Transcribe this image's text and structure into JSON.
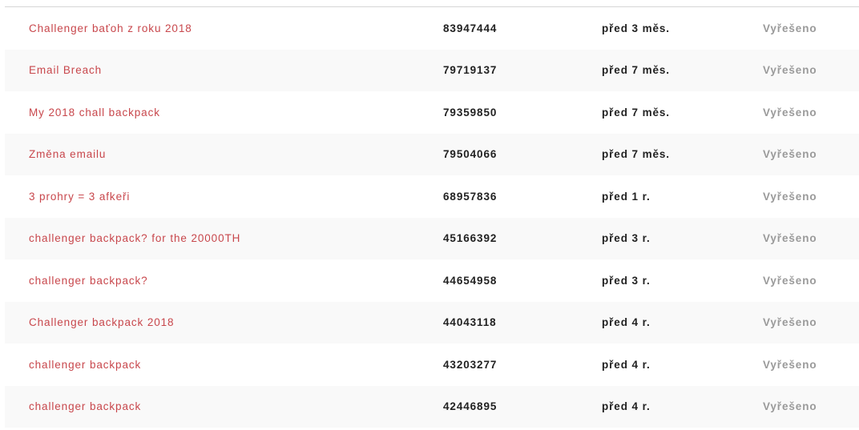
{
  "tickets": [
    {
      "subject": "Challenger baťoh z roku 2018",
      "id": "83947444",
      "date": "před 3 měs.",
      "status": "Vyřešeno"
    },
    {
      "subject": "Email Breach",
      "id": "79719137",
      "date": "před 7 měs.",
      "status": "Vyřešeno"
    },
    {
      "subject": "My 2018 chall backpack",
      "id": "79359850",
      "date": "před 7 měs.",
      "status": "Vyřešeno"
    },
    {
      "subject": "Změna emailu",
      "id": "79504066",
      "date": "před 7 měs.",
      "status": "Vyřešeno"
    },
    {
      "subject": "3 prohry = 3 afkeři",
      "id": "68957836",
      "date": "před 1 r.",
      "status": "Vyřešeno"
    },
    {
      "subject": "challenger backpack? for the 20000TH",
      "id": "45166392",
      "date": "před 3 r.",
      "status": "Vyřešeno"
    },
    {
      "subject": "challenger backpack?",
      "id": "44654958",
      "date": "před 3 r.",
      "status": "Vyřešeno"
    },
    {
      "subject": "Challenger backpack 2018",
      "id": "44043118",
      "date": "před 4 r.",
      "status": "Vyřešeno"
    },
    {
      "subject": "challenger backpack",
      "id": "43203277",
      "date": "před 4 r.",
      "status": "Vyřešeno"
    },
    {
      "subject": "challenger backpack",
      "id": "42446895",
      "date": "před 4 r.",
      "status": "Vyřešeno"
    }
  ],
  "colors": {
    "subject_link": "#c8474c",
    "text_dark": "#222222",
    "status_muted": "#9a9a9a",
    "row_alt": "#f9f9f9",
    "divider": "#d6d6d6"
  }
}
